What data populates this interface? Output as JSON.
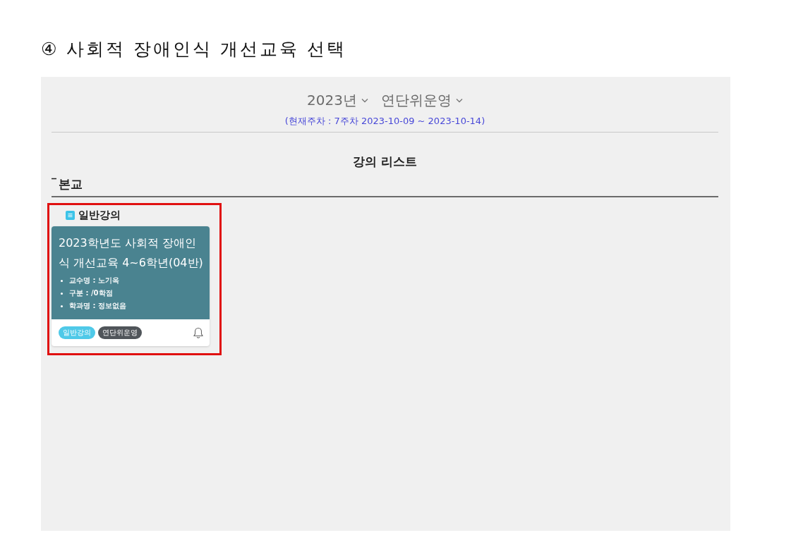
{
  "heading": "④ 사회적 장애인식 개선교육 선택",
  "screen": {
    "year_select": "2023년",
    "term_select": "연단위운영",
    "current_week": "(현재주차 : 7주차 2023-10-09 ~ 2023-10-14)",
    "list_title": "강의 리스트",
    "campus": {
      "label": "본교",
      "expanded": true
    },
    "category": "일반강의",
    "courses": [
      {
        "title": "2023학년도 사회적 장애인식 개선교육 4~6학년(04반)",
        "details": [
          "교수명 : 노기옥",
          "구분 : /0학점",
          "학과명 : 정보없음"
        ],
        "tags": [
          {
            "label": "일반강의",
            "color": "#4fc9e8"
          },
          {
            "label": "연단위운영",
            "color": "#50555a"
          }
        ],
        "highlighted": true
      }
    ]
  }
}
